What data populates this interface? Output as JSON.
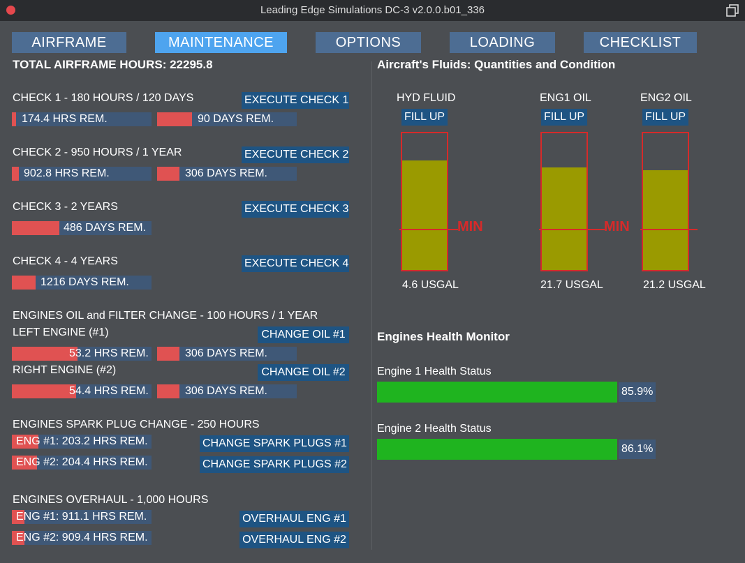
{
  "window": {
    "title": "Leading Edge Simulations DC-3 v2.0.0.b01_336"
  },
  "tabs": [
    "AIRFRAME",
    "MAINTENANCE",
    "OPTIONS",
    "LOADING",
    "CHECKLIST"
  ],
  "active_tab": "MAINTENANCE",
  "airframe": {
    "total_hours": "TOTAL AIRFRAME HOURS: 22295.8"
  },
  "checks": [
    {
      "title": "CHECK 1 - 180 HOURS / 120 DAYS",
      "button": "EXECUTE CHECK 1",
      "hrs": "174.4 HRS REM.",
      "hrs_fraction": 0.03,
      "days": "90 DAYS REM.",
      "days_fraction": 0.25
    },
    {
      "title": "CHECK 2 - 950 HOURS / 1 YEAR",
      "button": "EXECUTE CHECK 2",
      "hrs": "902.8 HRS REM.",
      "hrs_fraction": 0.05,
      "days": "306 DAYS REM.",
      "days_fraction": 0.16
    },
    {
      "title": "CHECK 3 - 2 YEARS",
      "button": "EXECUTE CHECK 3",
      "days": "486 DAYS REM.",
      "days_fraction": 0.34
    },
    {
      "title": "CHECK 4 - 4 YEARS",
      "button": "EXECUTE CHECK 4",
      "days": "1216 DAYS REM.",
      "days_fraction": 0.17
    }
  ],
  "oil": {
    "title": "ENGINES OIL and FILTER CHANGE - 100 HOURS / 1 YEAR",
    "left": {
      "label": "LEFT ENGINE (#1)",
      "button": "CHANGE OIL #1",
      "hrs": "53.2 HRS REM.",
      "hrs_fraction": 0.47,
      "days": "306 DAYS REM.",
      "days_fraction": 0.16
    },
    "right": {
      "label": "RIGHT ENGINE (#2)",
      "button": "CHANGE OIL #2",
      "hrs": "54.4 HRS REM.",
      "hrs_fraction": 0.46,
      "days": "306 DAYS REM.",
      "days_fraction": 0.16
    }
  },
  "spark": {
    "title": "ENGINES SPARK PLUG CHANGE - 250 HOURS",
    "eng1": {
      "text": "ENG #1: 203.2 HRS REM.",
      "fraction": 0.19,
      "button": "CHANGE SPARK PLUGS #1"
    },
    "eng2": {
      "text": "ENG #2: 204.4 HRS REM.",
      "fraction": 0.18,
      "button": "CHANGE SPARK PLUGS #2"
    }
  },
  "overhaul": {
    "title": "ENGINES OVERHAUL - 1,000 HOURS",
    "eng1": {
      "text": "ENG #1: 911.1 HRS REM.",
      "fraction": 0.09,
      "button": "OVERHAUL ENG #1"
    },
    "eng2": {
      "text": "ENG #2: 909.4 HRS REM.",
      "fraction": 0.09,
      "button": "OVERHAUL ENG #2"
    }
  },
  "fluids": {
    "title": "Aircraft's Fluids: Quantities and Condition",
    "fill_label": "FILL UP",
    "min_label": "MIN",
    "tanks": [
      {
        "name": "HYD FLUID",
        "quantity": "4.6 USGAL",
        "level": 0.8
      },
      {
        "name": "ENG1 OIL",
        "quantity": "21.7 USGAL",
        "level": 0.75
      },
      {
        "name": "ENG2 OIL",
        "quantity": "21.2 USGAL",
        "level": 0.73
      }
    ]
  },
  "health": {
    "title": "Engines Health Monitor",
    "engines": [
      {
        "label": "Engine 1 Health Status",
        "value": "85.9%",
        "fraction": 0.859
      },
      {
        "label": "Engine 2 Health Status",
        "value": "86.1%",
        "fraction": 0.861
      }
    ]
  },
  "colors": {
    "tab": "#4d6d93",
    "tab_active": "#4ea4ef",
    "button": "#1e5483",
    "bar_bg": "#3f5877",
    "bar_fill": "#e05252",
    "fluid": "#9a9a00",
    "health": "#1fb41f",
    "min_line": "#d62a2a"
  }
}
